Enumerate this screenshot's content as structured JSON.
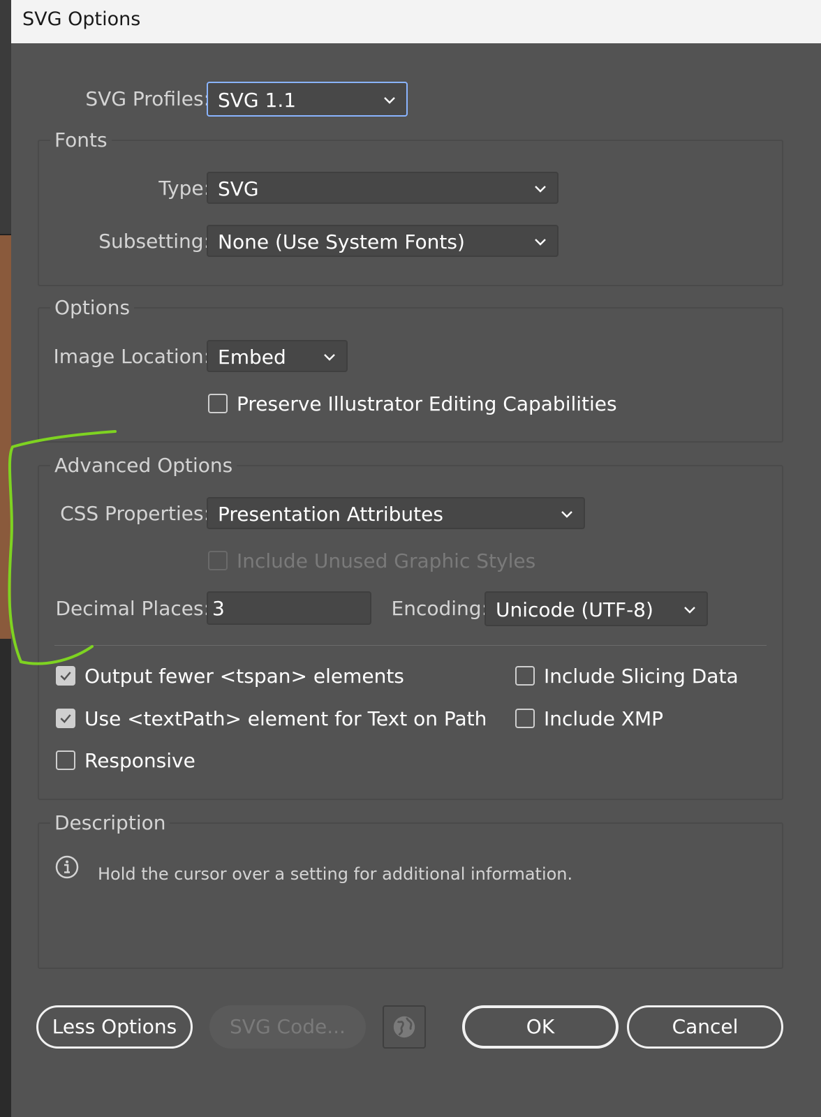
{
  "dialog": {
    "title": "SVG Options"
  },
  "profile": {
    "label": "SVG Profiles:",
    "value": "SVG 1.1"
  },
  "fonts": {
    "legend": "Fonts",
    "type_label": "Type:",
    "type_value": "SVG",
    "subsetting_label": "Subsetting:",
    "subsetting_value": "None (Use System Fonts)"
  },
  "options": {
    "legend": "Options",
    "image_location_label": "Image Location:",
    "image_location_value": "Embed",
    "preserve_label": "Preserve Illustrator Editing Capabilities",
    "preserve_checked": false
  },
  "advanced": {
    "legend": "Advanced Options",
    "css_label": "CSS Properties:",
    "css_value": "Presentation Attributes",
    "unused_styles_label": "Include Unused Graphic Styles",
    "decimal_label": "Decimal Places:",
    "decimal_value": "3",
    "encoding_label": "Encoding:",
    "encoding_value": "Unicode (UTF-8)",
    "checkboxes": [
      {
        "label": "Output fewer <tspan> elements",
        "checked": true
      },
      {
        "label": "Use <textPath> element for Text on Path",
        "checked": true
      },
      {
        "label": "Responsive",
        "checked": false
      },
      {
        "label": "Include Slicing Data",
        "checked": false
      },
      {
        "label": "Include XMP",
        "checked": false
      }
    ]
  },
  "description": {
    "legend": "Description",
    "text": "Hold the cursor over a setting for additional information."
  },
  "buttons": {
    "less_options": "Less Options",
    "svg_code": "SVG Code...",
    "ok": "OK",
    "cancel": "Cancel"
  },
  "colors": {
    "annotation": "#7ed321",
    "focus_ring": "#8ab4ff",
    "dialog_bg": "#535353"
  }
}
